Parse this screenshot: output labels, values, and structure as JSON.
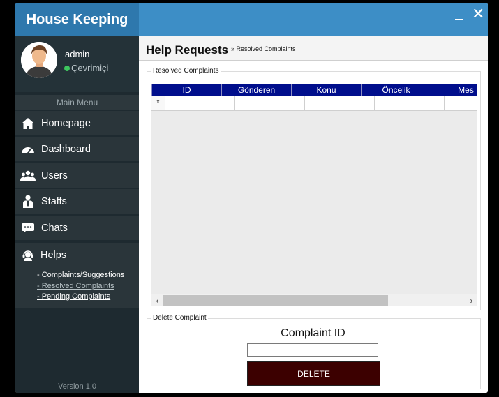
{
  "window": {
    "app_title": "House Keeping",
    "close_glyph": "✕"
  },
  "sidebar": {
    "user": {
      "name": "admin",
      "status": "Çevrimiçi",
      "status_color": "#3ec75f"
    },
    "menu_header": "Main Menu",
    "items": [
      {
        "label": "Homepage",
        "icon": "home-icon"
      },
      {
        "label": "Dashboard",
        "icon": "dashboard-icon"
      },
      {
        "label": "Users",
        "icon": "users-icon"
      },
      {
        "label": "Staffs",
        "icon": "staff-icon"
      },
      {
        "label": "Chats",
        "icon": "chat-icon"
      }
    ],
    "helps": {
      "label": "Helps",
      "icon": "headset-icon",
      "sublinks": [
        {
          "label": "- Complaints/Suggestions"
        },
        {
          "label": "- Resolved Complaints"
        },
        {
          "label": "- Pending Complaints"
        }
      ]
    },
    "version": "Version 1.0"
  },
  "main": {
    "title": "Help Requests",
    "breadcrumb": "» Resolved Complaints",
    "resolved_group": {
      "label": "Resolved Complaints",
      "columns": [
        "ID",
        "Gönderen",
        "Konu",
        "Öncelik",
        "Mes"
      ],
      "new_row_marker": "*"
    },
    "delete_group": {
      "label": "Delete Complaint",
      "field_label": "Complaint ID",
      "field_value": "",
      "button_label": "DELETE"
    }
  },
  "colors": {
    "titlebar": "#3d8ec6",
    "sidebar": "#1e2a30",
    "grid_header": "#000e8c",
    "delete_button": "#3c0000"
  }
}
